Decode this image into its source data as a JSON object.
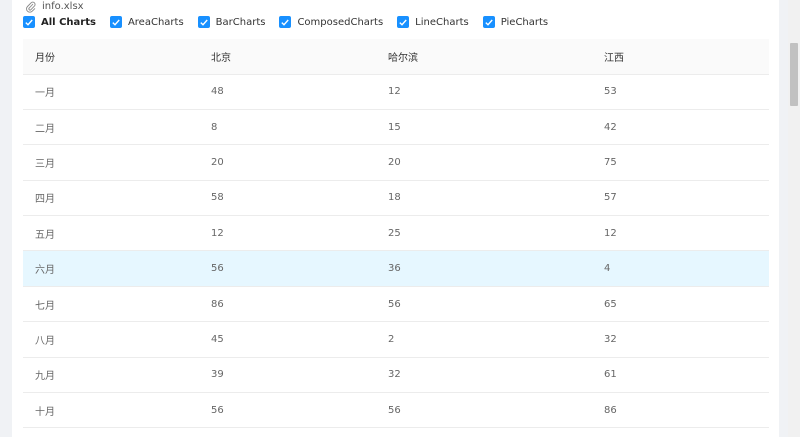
{
  "file": {
    "name": "info.xlsx",
    "icon": "paperclip-icon"
  },
  "filters": [
    {
      "label": "All Charts",
      "checked": true
    },
    {
      "label": "AreaCharts",
      "checked": true
    },
    {
      "label": "BarCharts",
      "checked": true
    },
    {
      "label": "ComposedCharts",
      "checked": true
    },
    {
      "label": "LineCharts",
      "checked": true
    },
    {
      "label": "PieCharts",
      "checked": true
    }
  ],
  "table": {
    "columns": [
      "月份",
      "北京",
      "哈尔滨",
      "江西"
    ],
    "rows": [
      [
        "一月",
        "48",
        "12",
        "53"
      ],
      [
        "二月",
        "8",
        "15",
        "42"
      ],
      [
        "三月",
        "20",
        "20",
        "75"
      ],
      [
        "四月",
        "58",
        "18",
        "57"
      ],
      [
        "五月",
        "12",
        "25",
        "12"
      ],
      [
        "六月",
        "56",
        "36",
        "4"
      ],
      [
        "七月",
        "86",
        "56",
        "65"
      ],
      [
        "八月",
        "45",
        "2",
        "32"
      ],
      [
        "九月",
        "39",
        "32",
        "61"
      ],
      [
        "十月",
        "56",
        "56",
        "86"
      ]
    ],
    "highlighted_row": 5
  },
  "colors": {
    "accent": "#1890ff",
    "row_highlight": "#e6f7ff",
    "header_bg": "#fafafa"
  }
}
